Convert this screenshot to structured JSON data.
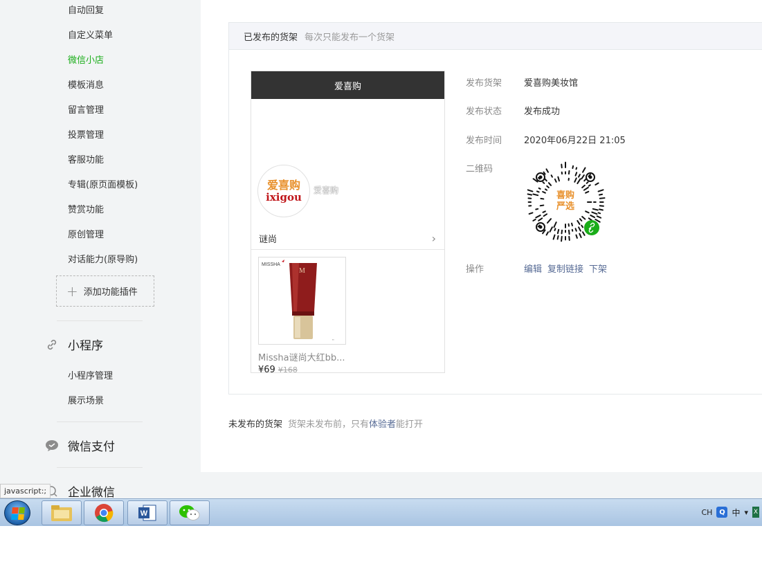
{
  "sidebar": {
    "items": [
      {
        "label": "自动回复",
        "active": false
      },
      {
        "label": "自定义菜单",
        "active": false
      },
      {
        "label": "微信小店",
        "active": true
      },
      {
        "label": "模板消息",
        "active": false
      },
      {
        "label": "留言管理",
        "active": false
      },
      {
        "label": "投票管理",
        "active": false
      },
      {
        "label": "客服功能",
        "active": false
      },
      {
        "label": "专辑(原页面模板)",
        "active": false
      },
      {
        "label": "赞赏功能",
        "active": false
      },
      {
        "label": "原创管理",
        "active": false
      },
      {
        "label": "对话能力(原导购)",
        "active": false
      }
    ],
    "add_plugin_label": "添加功能插件",
    "mini_program": {
      "title": "小程序",
      "icon": "link-icon",
      "items": [
        {
          "label": "小程序管理"
        },
        {
          "label": "展示场景"
        }
      ]
    },
    "wechat_pay": {
      "title": "微信支付",
      "icon": "wechat-pay-icon"
    },
    "work_wechat": {
      "title": "企业微信",
      "icon": "work-wechat-icon"
    }
  },
  "published_shelf": {
    "title": "已发布的货架",
    "tip": "每次只能发布一个货架",
    "preview": {
      "header": "爱喜购",
      "logo_line1": "爱喜购",
      "logo_line2": "ixigou",
      "shop_name": "爱喜购",
      "category": "谜尚",
      "product_name": "Missha谜尚大红bb...",
      "price": "¥69",
      "original_price": "¥168"
    },
    "info": {
      "shelf_label": "发布货架",
      "shelf_value": "爱喜购美妆馆",
      "status_label": "发布状态",
      "status_value": "发布成功",
      "time_label": "发布时间",
      "time_value": "2020年06月22日 21:05",
      "qr_label": "二维码",
      "qr_center_line1": "喜购",
      "qr_center_line2": "严选",
      "ops_label": "操作",
      "ops": [
        "编辑",
        "复制链接",
        "下架"
      ]
    }
  },
  "unpublished_shelf": {
    "title": "未发布的货架",
    "tip_prefix": "货架未发布前，只有",
    "tip_link": "体验者",
    "tip_suffix": "能打开"
  },
  "status_bar": {
    "url": "javascript:;"
  },
  "taskbar": {
    "apps": [
      {
        "name": "file-explorer",
        "icon": "folder-icon"
      },
      {
        "name": "chrome",
        "icon": "chrome-icon"
      },
      {
        "name": "word",
        "icon": "word-icon"
      },
      {
        "name": "wechat",
        "icon": "wechat-icon"
      }
    ],
    "tray": {
      "lang": "CH",
      "ime": "中"
    }
  },
  "colors": {
    "active": "#1aad19",
    "link": "#576b95",
    "preview_header": "#333333"
  }
}
